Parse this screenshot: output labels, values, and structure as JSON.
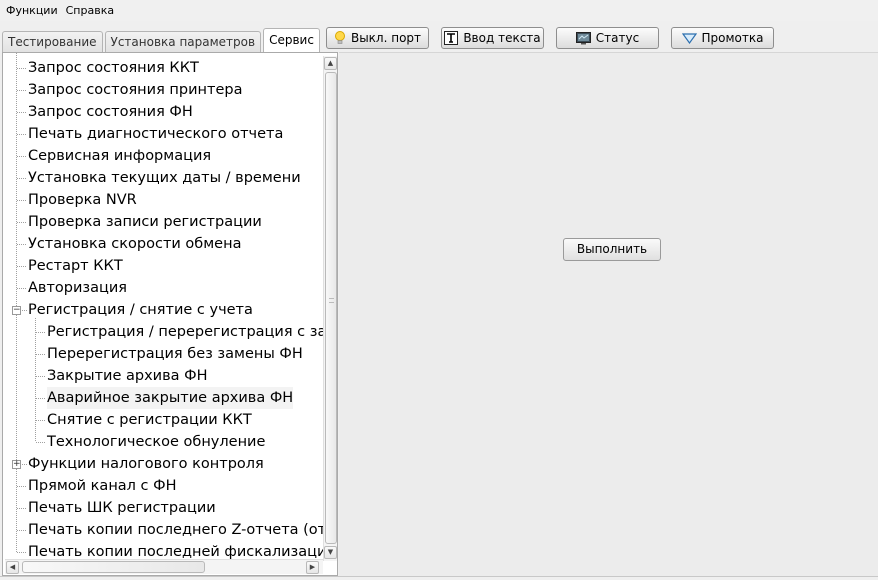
{
  "menu": {
    "items": [
      "Функции",
      "Справка"
    ]
  },
  "tabs": [
    {
      "label": "Тестирование",
      "active": false
    },
    {
      "label": "Установка параметров",
      "active": false
    },
    {
      "label": "Сервис",
      "active": true
    }
  ],
  "toolbar": {
    "port_label": "Выкл. порт",
    "text_label": "Ввод текста",
    "status_label": "Статус",
    "scroll_label": "Промотка"
  },
  "tree": {
    "items": [
      {
        "label": "Запрос состояния ККТ"
      },
      {
        "label": "Запрос состояния принтера"
      },
      {
        "label": "Запрос состояния ФН"
      },
      {
        "label": "Печать диагностического отчета"
      },
      {
        "label": "Сервисная информация"
      },
      {
        "label": "Установка текущих даты / времени"
      },
      {
        "label": "Проверка NVR"
      },
      {
        "label": "Проверка записи регистрации"
      },
      {
        "label": "Установка скорости обмена"
      },
      {
        "label": "Рестарт ККТ"
      },
      {
        "label": "Авторизация"
      },
      {
        "label": "Регистрация / снятие с учета"
      },
      {
        "label": "Регистрация / перерегистрация с замен"
      },
      {
        "label": "Перерегистрация без замены ФН"
      },
      {
        "label": "Закрытие архива ФН"
      },
      {
        "label": "Аварийное закрытие архива ФН"
      },
      {
        "label": "Снятие с регистрации ККТ"
      },
      {
        "label": "Технологическое обнуление"
      },
      {
        "label": "Функции налогового контроля"
      },
      {
        "label": "Прямой канал с ФН"
      },
      {
        "label": "Печать ШК регистрации"
      },
      {
        "label": "Печать копии последнего Z-отчета (отч"
      },
      {
        "label": "Печать копии последней фискализации"
      }
    ]
  },
  "main": {
    "execute_label": "Выполнить"
  }
}
